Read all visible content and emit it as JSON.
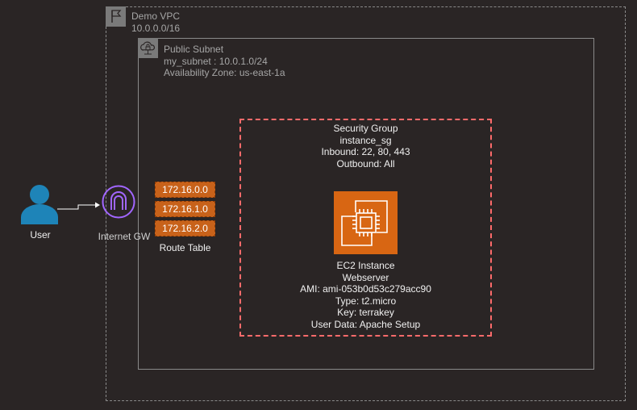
{
  "vpc": {
    "title": "Demo VPC",
    "cidr": "10.0.0.0/16",
    "icon": "flag-icon"
  },
  "subnet": {
    "title": "Public Subnet",
    "name_line": "my_subnet : 10.0.1.0/24",
    "az_line": "Availability Zone: us-east-1a",
    "icon": "cloud-lock-icon"
  },
  "security_group": {
    "lines": [
      "Security Group",
      "instance_sg",
      "Inbound: 22, 80, 443",
      "Outbound: All"
    ]
  },
  "ec2": {
    "icon": "ec2-chip-icon",
    "lines": [
      "EC2 Instance",
      "Webserver",
      "AMI: ami-053b0d53c279acc90",
      "Type: t2.micro",
      "Key: terrakey",
      "User Data: Apache Setup"
    ]
  },
  "route_table": {
    "caption": "Route Table",
    "entries": [
      "172.16.0.0",
      "172.16.1.0",
      "172.16.2.0"
    ]
  },
  "internet_gateway": {
    "label": "Internet GW",
    "icon": "internet-gateway-icon"
  },
  "user": {
    "label": "User",
    "icon": "user-icon"
  },
  "colors": {
    "background": "#2a2525",
    "group_border": "#8a8a8a",
    "security_group_border": "#ff6b6b",
    "ec2_orange": "#d86613",
    "route_orange": "#c8621a",
    "igw_purple": "#a166ff",
    "user_blue": "#1e84b8"
  }
}
